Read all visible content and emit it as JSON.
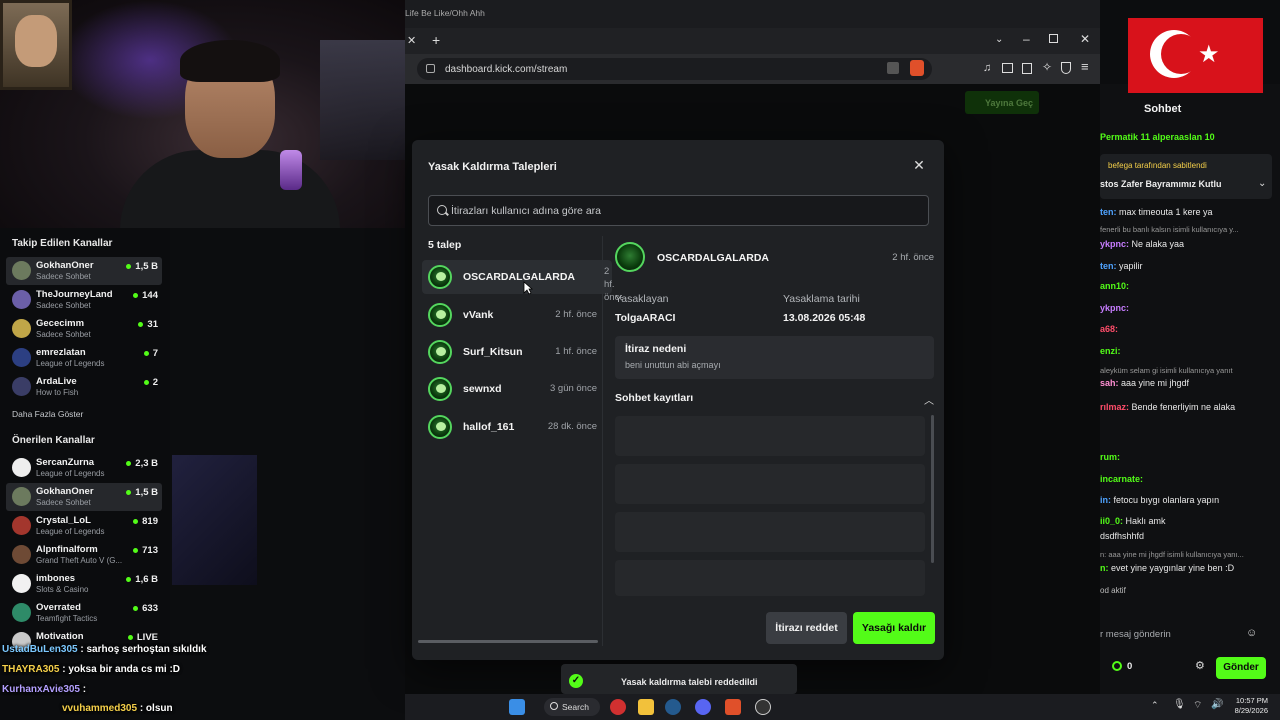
{
  "browser": {
    "tab_text": "Life Be Like/Ohh Ahh",
    "url": "dashboard.kick.com/stream",
    "go_live_label": "Yayına Geç"
  },
  "sidebar": {
    "followed_title": "Takip Edilen Kanallar",
    "followed": [
      {
        "name": "GokhanOner",
        "game": "Sadece Sohbet",
        "viewers": "1,5 B",
        "active": true
      },
      {
        "name": "TheJourneyLand",
        "game": "Sadece Sohbet",
        "viewers": "144"
      },
      {
        "name": "Gececimm",
        "game": "Sadece Sohbet",
        "viewers": "31"
      },
      {
        "name": "emrezlatan",
        "game": "League of Legends",
        "viewers": "7"
      },
      {
        "name": "ArdaLive",
        "game": "How to Fish",
        "viewers": "2"
      }
    ],
    "show_more": "Daha Fazla Göster",
    "recommended_title": "Önerilen Kanallar",
    "recommended": [
      {
        "name": "SercanZurna",
        "game": "League of Legends",
        "viewers": "2,3 B"
      },
      {
        "name": "GokhanOner",
        "game": "Sadece Sohbet",
        "viewers": "1,5 B",
        "active": true
      },
      {
        "name": "Crystal_LoL",
        "game": "League of Legends",
        "viewers": "819"
      },
      {
        "name": "Alpnfinalform",
        "game": "Grand Theft Auto V (G...",
        "viewers": "713"
      },
      {
        "name": "imbones",
        "game": "Slots & Casino",
        "viewers": "1,6 B"
      },
      {
        "name": "Overrated",
        "game": "Teamfight Tactics",
        "viewers": "633"
      },
      {
        "name": "Motivation",
        "game": "",
        "viewers": "LIVE"
      }
    ]
  },
  "modal": {
    "title": "Yasak Kaldırma Talepleri",
    "search_placeholder": "İtirazları kullanıcı adına göre ara",
    "count_label": "5 talep",
    "requests": [
      {
        "name": "OSCARDALGALARDA",
        "time": "2 hf. önce",
        "active": true
      },
      {
        "name": "vVank",
        "time": "2 hf. önce"
      },
      {
        "name": "Surf_Kitsun",
        "time": "1 hf. önce"
      },
      {
        "name": "sewnxd",
        "time": "3 gün önce"
      },
      {
        "name": "hallof_161",
        "time": "28 dk. önce"
      }
    ],
    "detail": {
      "name": "OSCARDALGALARDA",
      "time": "2 hf. önce",
      "banned_by_label": "Yasaklayan",
      "banned_by": "TolgaARACI",
      "ban_date_label": "Yasaklama tarihi",
      "ban_date": "13.08.2026 05:48",
      "reason_title": "İtiraz nedeni",
      "reason_text": "beni unuttun abi açmayı",
      "logs_title": "Sohbet kayıtları"
    },
    "reject_label": "İtirazı reddet",
    "unban_label": "Yasağı kaldır"
  },
  "toast": "Yasak kaldırma talebi reddedildi",
  "chat": {
    "title": "Sohbet",
    "top_users": "Permatik 11   alperaaslan 10",
    "pinned_by": "befega tarafından sabitlendi",
    "pinned_text": "stos Zafer Bayramımız Kutlu",
    "lines": [
      {
        "u": "ten:",
        "t": " max timeouta 1 kere ya"
      },
      {
        "u": "fenerli bu banlı kalsın isimli kullanıcıya y...",
        "t": ""
      },
      {
        "u": "ykpnc:",
        "t": " Ne alaka yaa"
      },
      {
        "u": "ten:",
        "t": " yapilir"
      },
      {
        "u": "ann10:",
        "t": ""
      },
      {
        "u": "ykpnc:",
        "t": ""
      },
      {
        "u": "a68:",
        "t": ""
      },
      {
        "u": "enzi:",
        "t": ""
      },
      {
        "u": "aleyküm selam gi isimli kullanıcıya yanıt",
        "t": ""
      },
      {
        "u": "sah:",
        "t": " aaa yine mi jhgdf"
      },
      {
        "u": "rılmaz:",
        "t": " Bende fenerliyim ne alaka"
      },
      {
        "u": "rum:",
        "t": ""
      },
      {
        "u": "incarnate:",
        "t": ""
      },
      {
        "u": "in:",
        "t": " fetocu bıygı olanlara yapın"
      },
      {
        "u": "ii0_0:",
        "t": " Haklı amk"
      },
      {
        "u": "",
        "t": "dsdfhshhfd"
      },
      {
        "u": "n: aaa yine mi jhgdf isimli kullanıcıya yanı...",
        "t": ""
      },
      {
        "u": "n:",
        "t": " evet yine yaygınlar yine ben :D"
      },
      {
        "u": "od aktif",
        "t": ""
      }
    ],
    "input_placeholder": "r mesaj gönderin",
    "points": "0",
    "send_label": "Gönder"
  },
  "overlay_chat": [
    {
      "u": "UstadBuLen305",
      "t": " :  sarhoş serhoştan sıkıldık"
    },
    {
      "u": "THAYRA305",
      "t": " : yoksa bir anda cs mi :D"
    },
    {
      "u": "KurhanxAvie305",
      "t": " : "
    },
    {
      "u": "vvuhammed305",
      "t": " : olsun"
    }
  ],
  "taskbar": {
    "search_label": "Search",
    "time": "10:57 PM",
    "date": "8/29/2026"
  }
}
